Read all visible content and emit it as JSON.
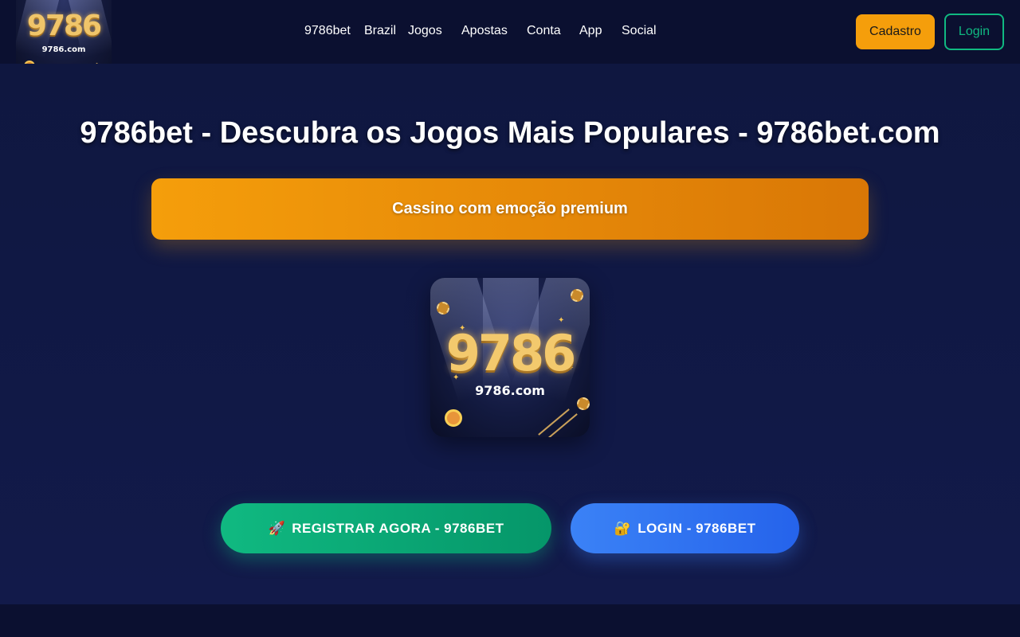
{
  "header": {
    "logo": {
      "number_text": "9786",
      "domain_text": "9786.com"
    },
    "nav": [
      {
        "label": "9786bet"
      },
      {
        "label": "Brazil"
      },
      {
        "label": "Jogos"
      },
      {
        "label": "Apostas"
      },
      {
        "label": "Conta"
      },
      {
        "label": "App"
      },
      {
        "label": "Social"
      }
    ],
    "cadastro_label": "Cadastro",
    "login_label": "Login"
  },
  "main": {
    "title": "9786bet - Descubra os Jogos Mais Populares - 9786bet.com",
    "banner_text": "Cassino com emoção premium",
    "hero_image": {
      "number_text": "9786",
      "domain_text": "9786.com"
    },
    "register_icon": "🚀",
    "register_label": "REGISTRAR AGORA - 9786BET",
    "login_icon": "🔐",
    "login_label": "LOGIN - 9786BET"
  },
  "colors": {
    "background": "#0b1030",
    "accent_orange": "#f59e0b",
    "accent_green": "#10b981",
    "accent_blue": "#3b82f6",
    "gold_text": "#f3c96d"
  },
  "icons": {
    "register": "rocket-icon",
    "login": "lock-key-icon"
  }
}
